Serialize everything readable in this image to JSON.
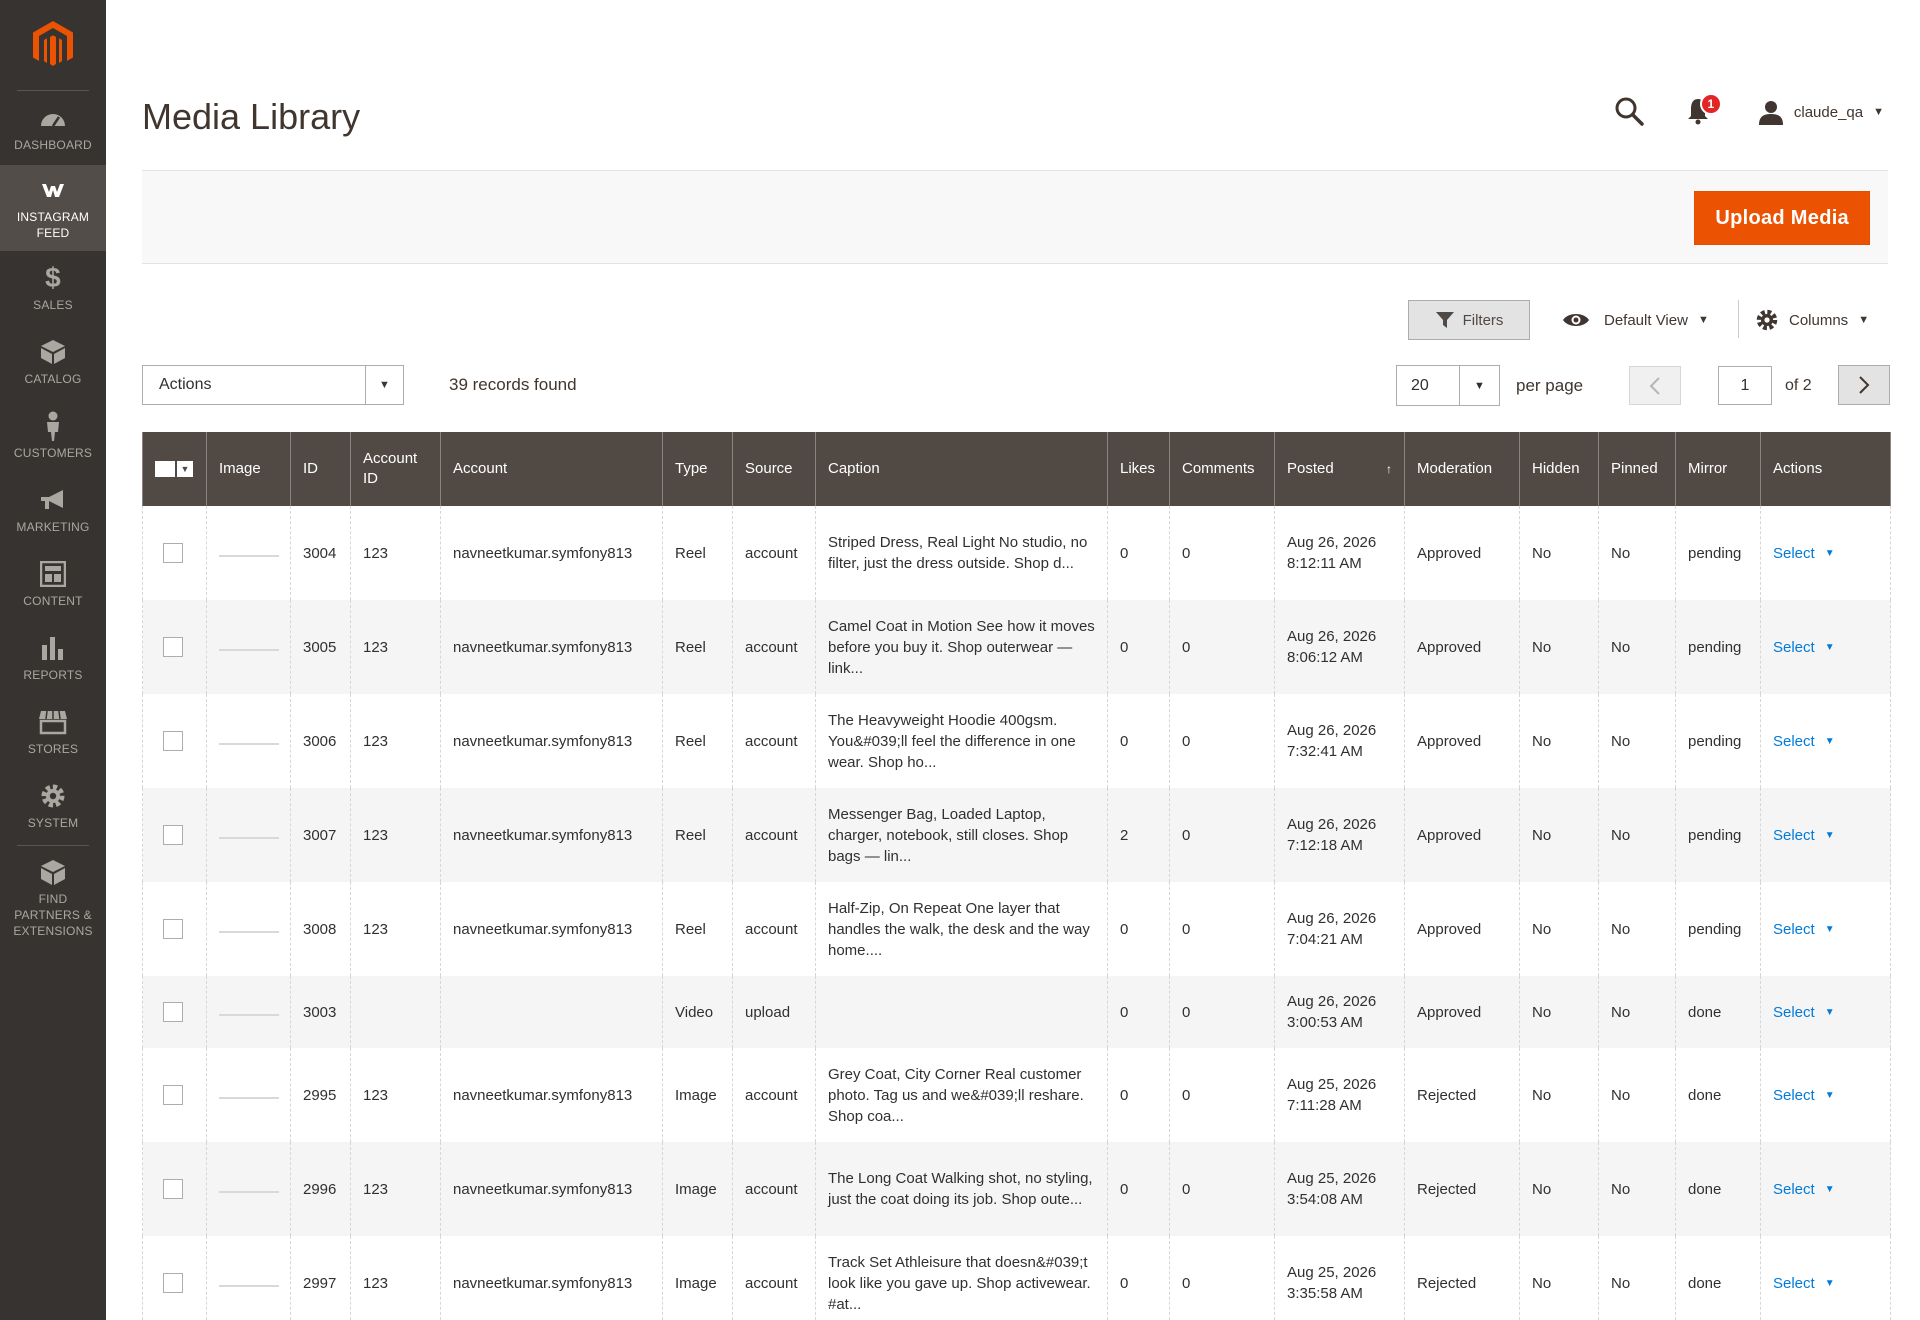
{
  "sidebar": {
    "items": [
      {
        "label": "DASHBOARD",
        "icon": "dashboard-icon"
      },
      {
        "label": "INSTAGRAM FEED",
        "icon": "instagram-feed-icon"
      },
      {
        "label": "SALES",
        "icon": "dollar-icon"
      },
      {
        "label": "CATALOG",
        "icon": "box-icon"
      },
      {
        "label": "CUSTOMERS",
        "icon": "person-icon"
      },
      {
        "label": "MARKETING",
        "icon": "megaphone-icon"
      },
      {
        "label": "CONTENT",
        "icon": "layout-icon"
      },
      {
        "label": "REPORTS",
        "icon": "bar-chart-icon"
      },
      {
        "label": "STORES",
        "icon": "store-icon"
      },
      {
        "label": "SYSTEM",
        "icon": "gear-icon"
      },
      {
        "label": "FIND PARTNERS & EXTENSIONS",
        "icon": "cube-icon"
      }
    ]
  },
  "header": {
    "title": "Media Library",
    "notifications_count": "1",
    "username": "claude_qa"
  },
  "toolbar": {
    "upload_label": "Upload Media",
    "filters_label": "Filters",
    "view_label": "Default View",
    "columns_label": "Columns",
    "actions_label": "Actions",
    "records_found": "39 records found",
    "per_page_value": "20",
    "per_page_label": "per page",
    "current_page": "1",
    "total_pages_label": "of 2"
  },
  "colors": {
    "accent": "#eb5202",
    "sidebar_bg": "#373330",
    "header_bg": "#514943",
    "link": "#007bdb"
  },
  "table": {
    "columns": [
      "Image",
      "ID",
      "Account ID",
      "Account",
      "Type",
      "Source",
      "Caption",
      "Likes",
      "Comments",
      "Posted",
      "Moderation",
      "Hidden",
      "Pinned",
      "Mirror",
      "Actions"
    ],
    "sort_indicator": "↑",
    "action_label": "Select",
    "rows": [
      {
        "id": "3004",
        "account_id": "123",
        "account": "navneetkumar.symfony813",
        "type": "Reel",
        "source": "account",
        "caption": "Striped Dress, Real Light No studio, no filter, just the dress outside. Shop d...",
        "likes": "0",
        "comments": "0",
        "posted_date": "Aug 26, 2026",
        "posted_time": "8:12:11 AM",
        "moderation": "Approved",
        "hidden": "No",
        "pinned": "No",
        "mirror": "pending"
      },
      {
        "id": "3005",
        "account_id": "123",
        "account": "navneetkumar.symfony813",
        "type": "Reel",
        "source": "account",
        "caption": "Camel Coat in Motion See how it moves before you buy it. Shop outerwear — link...",
        "likes": "0",
        "comments": "0",
        "posted_date": "Aug 26, 2026",
        "posted_time": "8:06:12 AM",
        "moderation": "Approved",
        "hidden": "No",
        "pinned": "No",
        "mirror": "pending"
      },
      {
        "id": "3006",
        "account_id": "123",
        "account": "navneetkumar.symfony813",
        "type": "Reel",
        "source": "account",
        "caption": "The Heavyweight Hoodie 400gsm. You&#039;ll feel the difference in one wear. Shop ho...",
        "likes": "0",
        "comments": "0",
        "posted_date": "Aug 26, 2026",
        "posted_time": "7:32:41 AM",
        "moderation": "Approved",
        "hidden": "No",
        "pinned": "No",
        "mirror": "pending"
      },
      {
        "id": "3007",
        "account_id": "123",
        "account": "navneetkumar.symfony813",
        "type": "Reel",
        "source": "account",
        "caption": "Messenger Bag, Loaded Laptop, charger, notebook, still closes. Shop bags — lin...",
        "likes": "2",
        "comments": "0",
        "posted_date": "Aug 26, 2026",
        "posted_time": "7:12:18 AM",
        "moderation": "Approved",
        "hidden": "No",
        "pinned": "No",
        "mirror": "pending"
      },
      {
        "id": "3008",
        "account_id": "123",
        "account": "navneetkumar.symfony813",
        "type": "Reel",
        "source": "account",
        "caption": "Half-Zip, On Repeat One layer that handles the walk, the desk and the way home....",
        "likes": "0",
        "comments": "0",
        "posted_date": "Aug 26, 2026",
        "posted_time": "7:04:21 AM",
        "moderation": "Approved",
        "hidden": "No",
        "pinned": "No",
        "mirror": "pending"
      },
      {
        "id": "3003",
        "account_id": "",
        "account": "",
        "type": "Video",
        "source": "upload",
        "caption": "",
        "likes": "0",
        "comments": "0",
        "posted_date": "Aug 26, 2026",
        "posted_time": "3:00:53 AM",
        "moderation": "Approved",
        "hidden": "No",
        "pinned": "No",
        "mirror": "done"
      },
      {
        "id": "2995",
        "account_id": "123",
        "account": "navneetkumar.symfony813",
        "type": "Image",
        "source": "account",
        "caption": "Grey Coat, City Corner Real customer photo. Tag us and we&#039;ll reshare. Shop coa...",
        "likes": "0",
        "comments": "0",
        "posted_date": "Aug 25, 2026",
        "posted_time": "7:11:28 AM",
        "moderation": "Rejected",
        "hidden": "No",
        "pinned": "No",
        "mirror": "done"
      },
      {
        "id": "2996",
        "account_id": "123",
        "account": "navneetkumar.symfony813",
        "type": "Image",
        "source": "account",
        "caption": "The Long Coat Walking shot, no styling, just the coat doing its job. Shop oute...",
        "likes": "0",
        "comments": "0",
        "posted_date": "Aug 25, 2026",
        "posted_time": "3:54:08 AM",
        "moderation": "Rejected",
        "hidden": "No",
        "pinned": "No",
        "mirror": "done"
      },
      {
        "id": "2997",
        "account_id": "123",
        "account": "navneetkumar.symfony813",
        "type": "Image",
        "source": "account",
        "caption": "Track Set Athleisure that doesn&#039;t look like you gave up. Shop activewear. #at...",
        "likes": "0",
        "comments": "0",
        "posted_date": "Aug 25, 2026",
        "posted_time": "3:35:58 AM",
        "moderation": "Rejected",
        "hidden": "No",
        "pinned": "No",
        "mirror": "done"
      }
    ]
  }
}
